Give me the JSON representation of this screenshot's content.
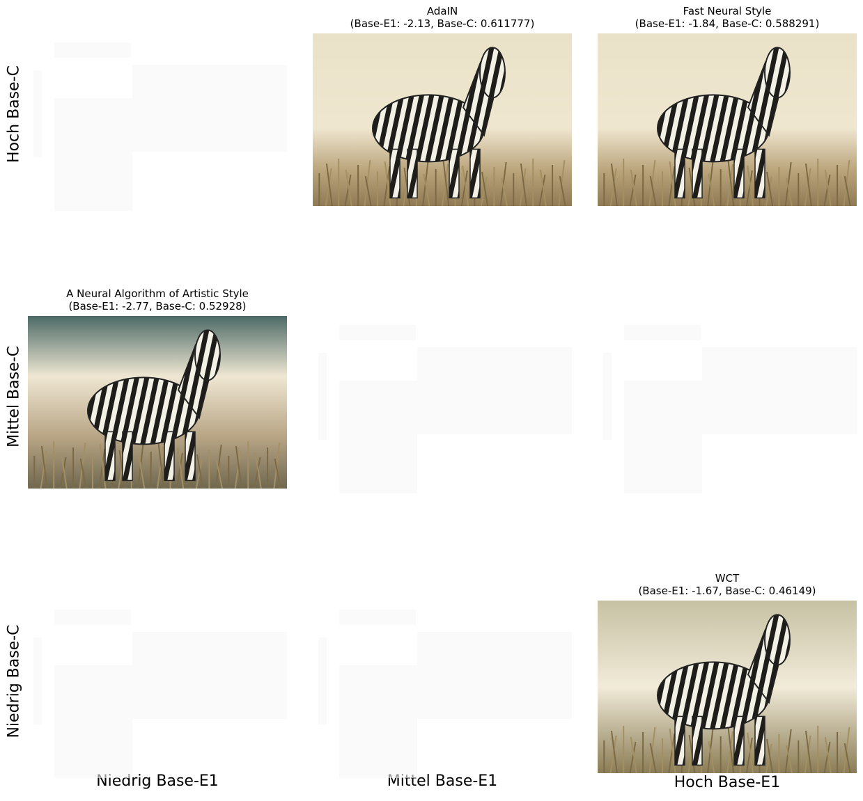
{
  "chart_data": {
    "type": "image-grid",
    "grid": {
      "rows": 3,
      "cols": 3
    },
    "row_labels": [
      "Hoch Base-C",
      "Mittel Base-C",
      "Niedrig Base-C"
    ],
    "col_labels": [
      "Niedrig Base-E1",
      "Mittel Base-E1",
      "Hoch Base-E1"
    ],
    "panels": [
      {
        "row": 0,
        "col": 1,
        "method": "AdaIN",
        "base_e1": -2.13,
        "base_c": 0.611777,
        "title": "AdaIN",
        "subtitle": "(Base-E1: -2.13, Base-C: 0.611777)",
        "image": "zebra-stylized"
      },
      {
        "row": 0,
        "col": 2,
        "method": "Fast Neural Style",
        "base_e1": -1.84,
        "base_c": 0.588291,
        "title": "Fast Neural Style",
        "subtitle": "(Base-E1: -1.84, Base-C: 0.588291)",
        "image": "zebra-stylized"
      },
      {
        "row": 1,
        "col": 0,
        "method": "A Neural Algorithm of Artistic Style",
        "base_e1": -2.77,
        "base_c": 0.52928,
        "title": "A Neural Algorithm of Artistic Style",
        "subtitle": "(Base-E1: -2.77, Base-C: 0.52928)",
        "image": "zebra-stylized"
      },
      {
        "row": 2,
        "col": 2,
        "method": "WCT",
        "base_e1": -1.67,
        "base_c": 0.46149,
        "title": "WCT",
        "subtitle": "(Base-E1: -1.67, Base-C: 0.46149)",
        "image": "zebra-stylized"
      }
    ],
    "empty_cells": [
      [
        0,
        0
      ],
      [
        1,
        1
      ],
      [
        1,
        2
      ],
      [
        2,
        0
      ],
      [
        2,
        1
      ]
    ]
  }
}
